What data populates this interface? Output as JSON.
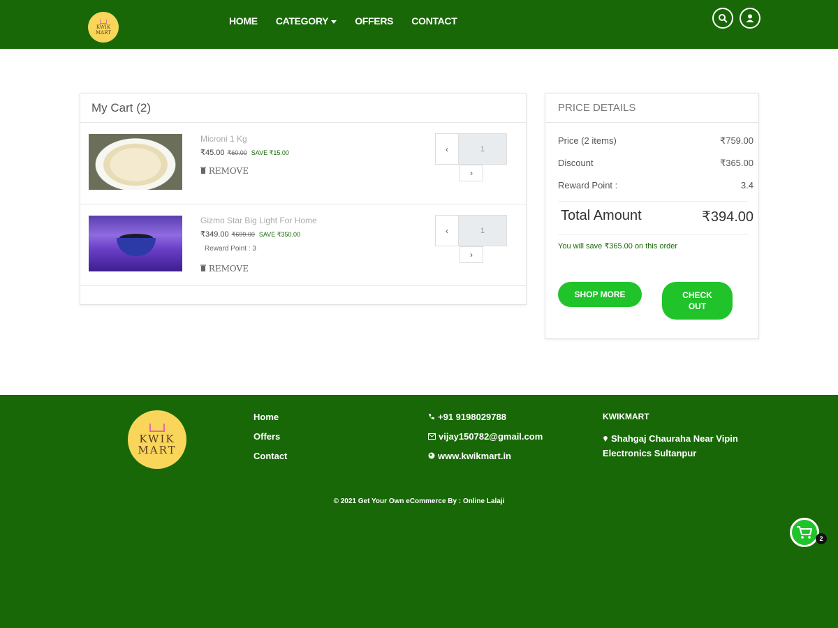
{
  "header": {
    "logo_line1": "KWIK",
    "logo_line2": "MART",
    "nav": [
      "HOME",
      "CATEGORY",
      "OFFERS",
      "CONTACT"
    ]
  },
  "cart": {
    "title": "My Cart (2)",
    "items": [
      {
        "name": "Microni 1 Kg",
        "price": "₹45.00",
        "old_price": "₹60.00",
        "save": "SAVE ₹15.00",
        "reward": "",
        "remove": "REMOVE",
        "qty": "1",
        "prev": "‹",
        "next": "›"
      },
      {
        "name": "Gizmo Star Big Light For Home",
        "price": "₹349.00",
        "old_price": "₹699.00",
        "save": "SAVE ₹350.00",
        "reward": "Reward Point : 3",
        "remove": "REMOVE",
        "qty": "1",
        "prev": "‹",
        "next": "›"
      }
    ]
  },
  "price_details": {
    "title": "PRICE DETAILS",
    "price_label": "Price (2 items)",
    "price_value": "₹759.00",
    "discount_label": "Discount",
    "discount_value": "₹365.00",
    "reward_label": "Reward Point :",
    "reward_value": "3.4",
    "total_label": "Total Amount",
    "total_value": "₹394.00",
    "save_note": "You will save ₹365.00 on this order",
    "shop_more": "SHOP MORE",
    "checkout_line1": "CHECK",
    "checkout_line2": "OUT"
  },
  "footer": {
    "links": [
      "Home",
      "Offers",
      "Contact"
    ],
    "phone": "+91 9198029788",
    "email": "vijay150782@gmail.com",
    "website": "www.kwikmart.in",
    "brand": "KWIKMART",
    "address_line1": "Shahgaj Chauraha Near Vipin",
    "address_line2": "Electronics Sultanpur",
    "copyright": "© 2021 Get Your Own eCommerce By : Online Lalaji"
  },
  "floating_cart": {
    "count": "2"
  },
  "colors": {
    "brand_green": "#196808",
    "button_green": "#20c42a",
    "logo_yellow": "#f9d65a"
  },
  "icons": [
    "search-icon",
    "user-icon",
    "trash-icon",
    "phone-icon",
    "mail-icon",
    "globe-icon",
    "map-pin-icon",
    "cart-icon"
  ]
}
